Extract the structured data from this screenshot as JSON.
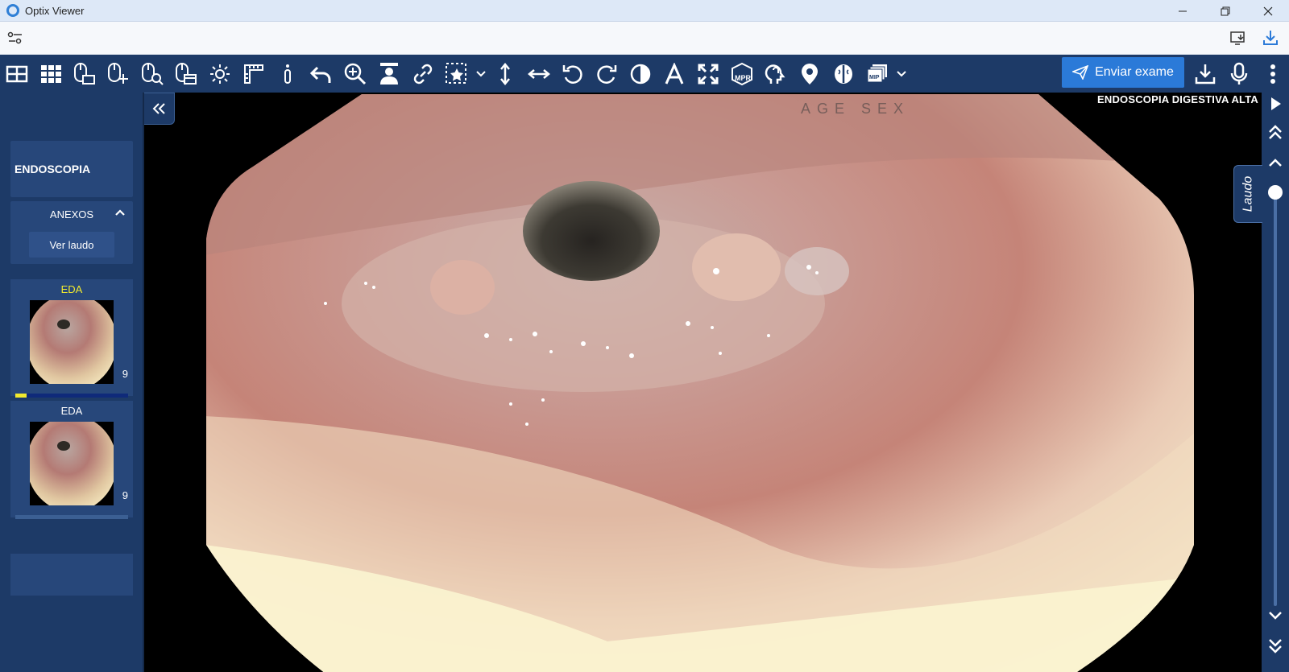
{
  "window": {
    "title": "Optix Viewer"
  },
  "toolbar": {
    "send_label": "Enviar exame",
    "icons": [
      "layout-grid-icon",
      "series-grid-icon",
      "mouse-stack-icon",
      "mouse-pan-icon",
      "mouse-zoom-icon",
      "mouse-window-icon",
      "brightness-icon",
      "ruler-icon",
      "probe-icon",
      "undo-icon",
      "zoom-in-icon",
      "person-icon",
      "link-icon",
      "star-roi-icon",
      "flip-vertical-icon",
      "flip-horizontal-icon",
      "rotate-left-icon",
      "rotate-right-icon",
      "invert-icon",
      "text-annotation-icon",
      "fit-screen-icon",
      "mpr-icon",
      "head-3d-icon",
      "location-icon",
      "brain-icon",
      "mip-icon"
    ]
  },
  "sidebar": {
    "study_label": "ENDOSCOPIA",
    "annex_label": "ANEXOS",
    "report_button": "Ver laudo",
    "series": [
      {
        "label": "EDA",
        "count": "9",
        "progress": 0.1,
        "active": true
      },
      {
        "label": "EDA",
        "count": "9",
        "progress": 0.0,
        "active": false
      }
    ]
  },
  "viewport": {
    "study_title": "ENDOSCOPIA DIGESTIVA ALTA",
    "overlay_faint": "AGE   SEX"
  },
  "right_rail": {
    "tab_label": "Laudo"
  },
  "colors": {
    "toolbar": "#1d3a67",
    "panel": "#27477a",
    "accent": "#2b7ad8",
    "active_series": "#f2ea2e"
  }
}
